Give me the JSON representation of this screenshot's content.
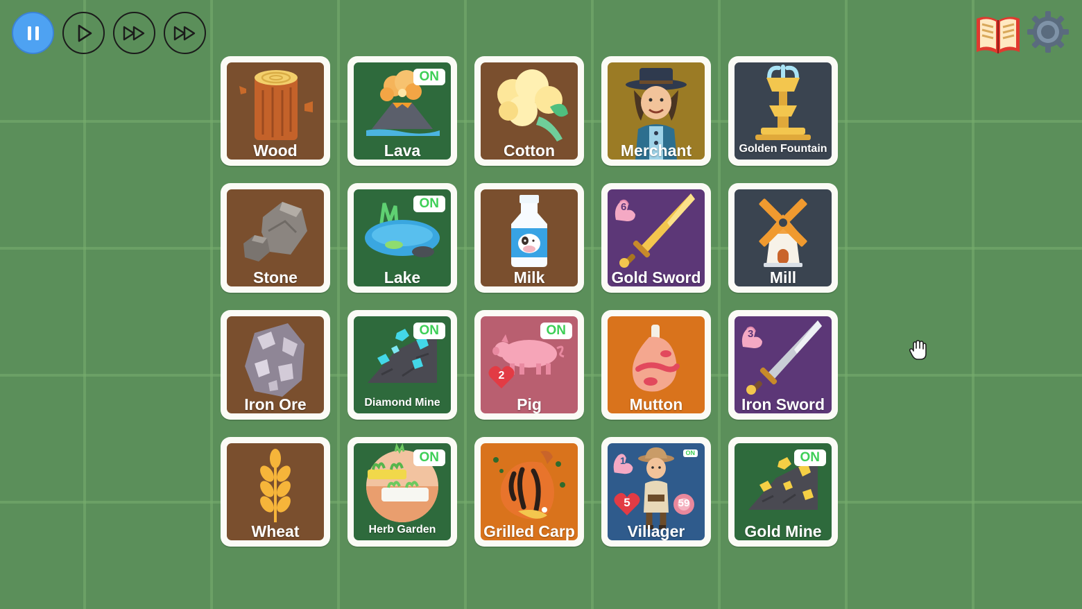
{
  "controls": {
    "pause": "pause-icon",
    "play": "play-icon",
    "fast": "fast-forward-icon",
    "faster": "faster-forward-icon"
  },
  "top_right": {
    "book": "recipe-book-icon",
    "settings": "gear-icon"
  },
  "colors": {
    "brown": "#7a4f2e",
    "green": "#2e6a3c",
    "purple": "#5c3777",
    "slate": "#3a4450",
    "olive": "#9b7b25",
    "orange": "#d9731c",
    "pink": "#b95f70",
    "blue": "#2f5b8c",
    "on_text": "#3ecf57"
  },
  "cards": [
    {
      "label": "Wood"
    },
    {
      "label": "Lava",
      "badge": "ON"
    },
    {
      "label": "Cotton"
    },
    {
      "label": "Merchant"
    },
    {
      "label": "Golden Fountain"
    },
    {
      "label": "Stone"
    },
    {
      "label": "Lake",
      "badge": "ON"
    },
    {
      "label": "Milk"
    },
    {
      "label": "Gold Sword",
      "attack": "6"
    },
    {
      "label": "Mill"
    },
    {
      "label": "Iron Ore"
    },
    {
      "label": "Diamond Mine",
      "badge": "ON"
    },
    {
      "label": "Pig",
      "badge": "ON",
      "health": "2"
    },
    {
      "label": "Mutton"
    },
    {
      "label": "Iron Sword",
      "attack": "3"
    },
    {
      "label": "Wheat"
    },
    {
      "label": "Herb Garden",
      "badge": "ON"
    },
    {
      "label": "Grilled Carp"
    },
    {
      "label": "Villager",
      "badge": "ON",
      "attack": "1",
      "health": "5",
      "food": "59"
    },
    {
      "label": "Gold Mine",
      "badge": "ON"
    }
  ]
}
